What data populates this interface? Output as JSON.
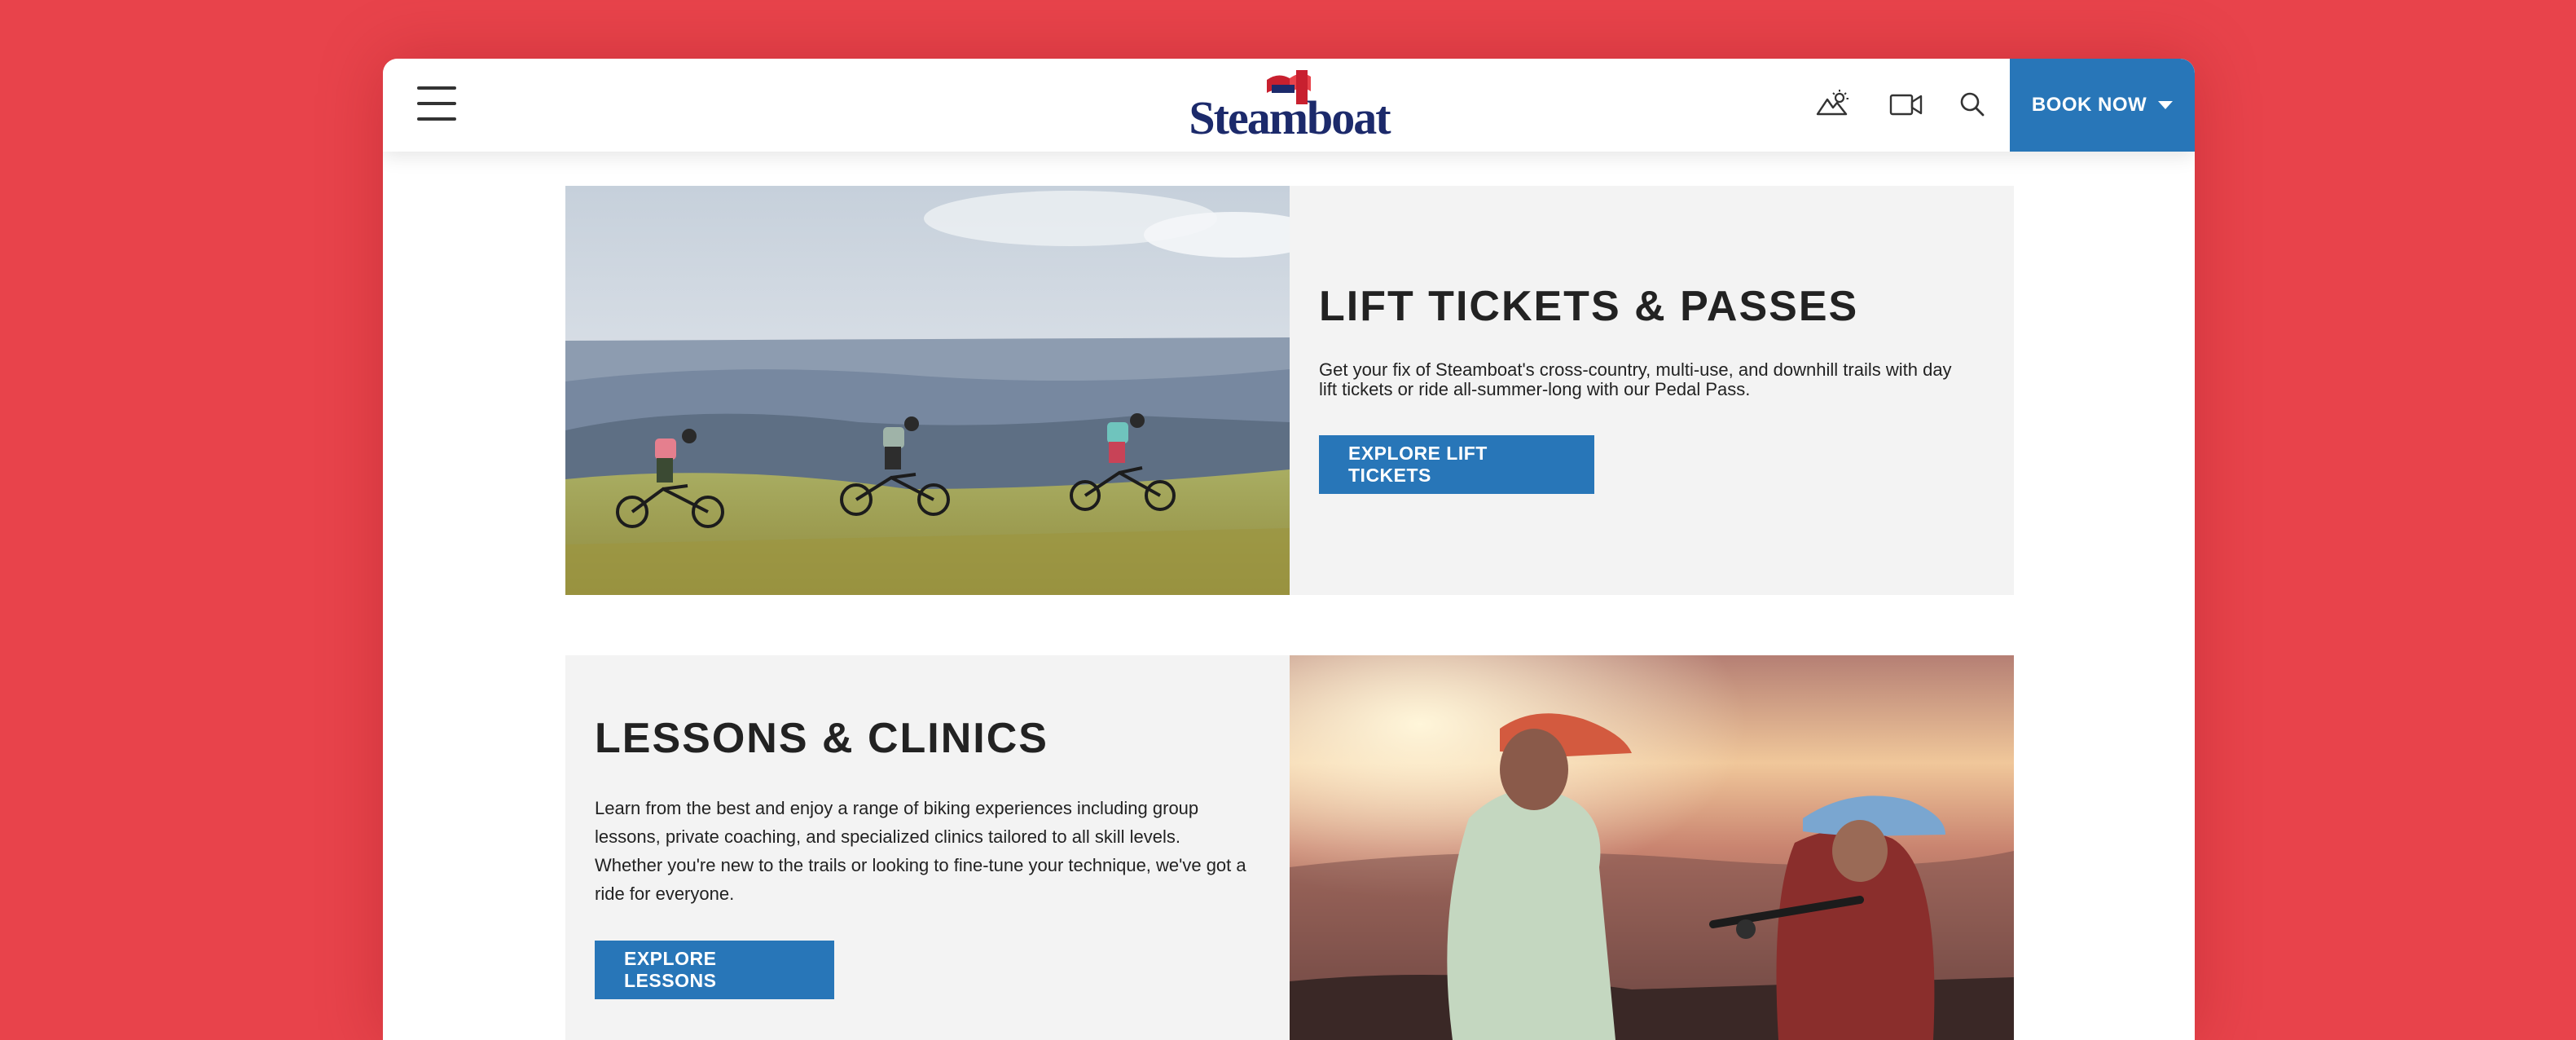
{
  "header": {
    "menu_icon": "hamburger-menu-icon",
    "logo_text": "Steamboat",
    "icons": [
      "weather-icon",
      "camera-icon",
      "search-icon"
    ],
    "book_now_label": "BOOK NOW",
    "brand_blue": "#2876b8",
    "logo_navy": "#1c2a6b"
  },
  "sections": [
    {
      "title": "LIFT TICKETS & PASSES",
      "description": "Get your fix of Steamboat's cross-country, multi-use, and downhill trails with day lift tickets or ride all-summer-long with our Pedal Pass.",
      "cta_label": "EXPLORE LIFT TICKETS",
      "image": "mountain-bikers-on-ridge-photo"
    },
    {
      "title": "LESSONS & CLINICS",
      "description": "Learn from the best and enjoy a range of biking experiences including group lessons, private coaching, and specialized clinics tailored to all skill levels. Whether you're new to the trails or looking to fine-tune your technique, we've got a ride for everyone.",
      "cta_label": "EXPLORE LESSONS",
      "image": "riders-at-sunset-photo"
    }
  ],
  "chat": {
    "icon": "chat-bubble-icon"
  },
  "colors": {
    "page_background": "#e8434b",
    "card_background": "#f3f3f3"
  }
}
